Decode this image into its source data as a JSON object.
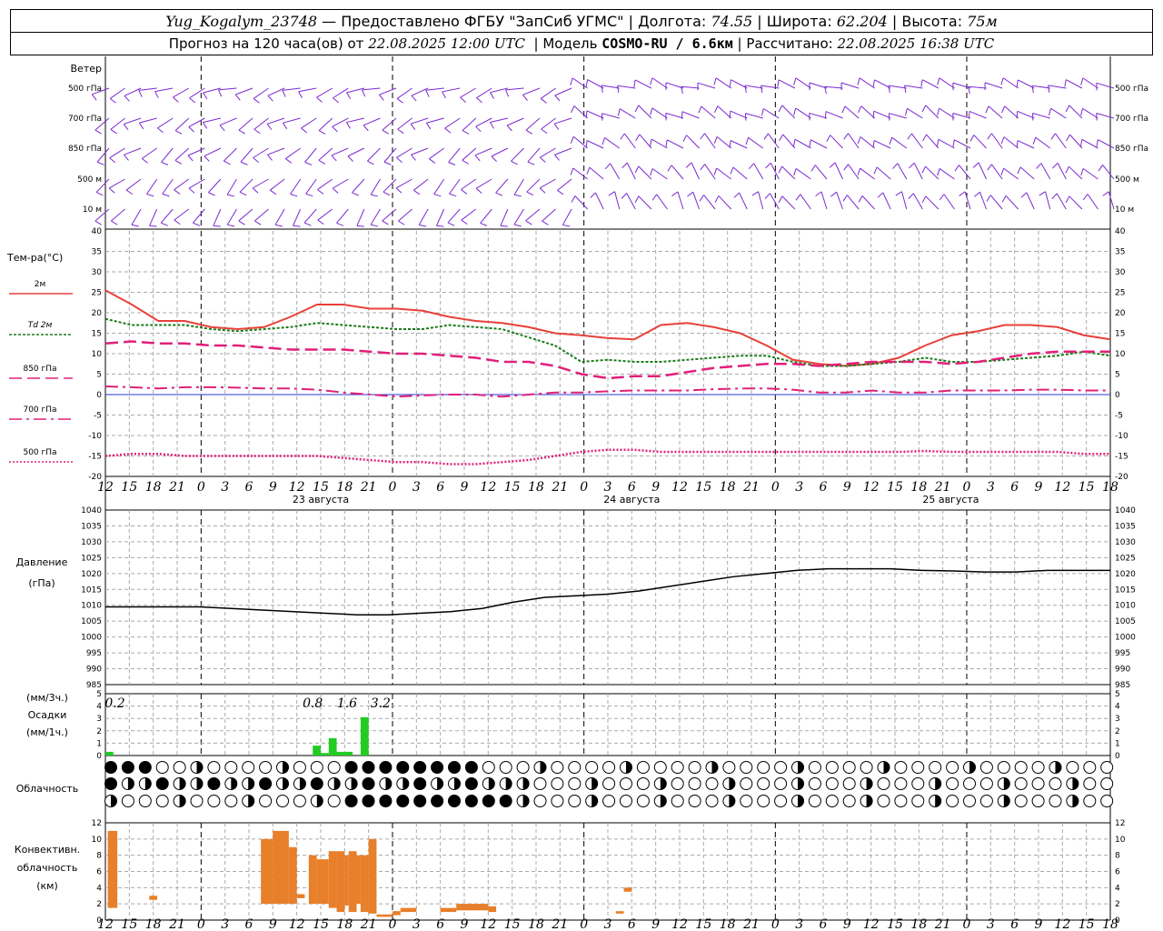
{
  "header": {
    "station": "Yug_Kogalym_23748",
    "provider": "— Предоставлено ФГБУ \"ЗапСиб УГМС\"",
    "lon_label": "Долгота:",
    "lon": "74.55",
    "lat_label": "Широта:",
    "lat": "62.204",
    "alt_label": "Высота:",
    "alt": "75м",
    "forecast_label": "Прогноз на 120 часа(ов) от",
    "forecast_from": "22.08.2025 12:00 UTC",
    "model_label": "Модель",
    "model": "COSMO-RU / 6.6км",
    "computed_label": "Рассчитано:",
    "computed": "22.08.2025 16:38 UTC"
  },
  "panels": {
    "wind": {
      "title": "Ветер",
      "levels": [
        "500 гПа",
        "700 гПа",
        "850 гПа",
        "500 м",
        "10  м"
      ]
    },
    "temp": {
      "title": "Тем-ра(°C)",
      "legend": [
        "2м",
        "Td  2м",
        "850 гПа",
        "700 гПа",
        "500 гПа"
      ]
    },
    "pressure": {
      "title1": "Давление",
      "title2": "(гПа)"
    },
    "precip": {
      "title1": "(мм/3ч.)",
      "title2": "Осадки",
      "title3": "(мм/1ч.)",
      "labels": [
        "0.2",
        "0.8",
        "1.6",
        "3.2"
      ]
    },
    "cloud": {
      "title": "Облачность"
    },
    "conv": {
      "title1": "Конвективн.",
      "title2": "облачность",
      "title3": "(км)"
    }
  },
  "dates": [
    "23 августа",
    "24 августа",
    "25 августа"
  ],
  "colors": {
    "t2m": "#e8403a",
    "td": "#1a7a1a",
    "t850": "#e0207a",
    "t700": "#e0207a",
    "t500": "#e0207a",
    "wind": "#7a2ad0",
    "precip": "#22cc22",
    "conv": "#e87f2a"
  },
  "chart_data": [
    {
      "type": "line",
      "name": "temperature",
      "x_hours": [
        0,
        3,
        6,
        9,
        12,
        15,
        18,
        21,
        24,
        27,
        30,
        33,
        36,
        39,
        42,
        45,
        48,
        51,
        54,
        57,
        60,
        63,
        66,
        69,
        72,
        75,
        78,
        81,
        84,
        87,
        90,
        93,
        96,
        99,
        102,
        105,
        108,
        111,
        114,
        117,
        120,
        123,
        126
      ],
      "x_tick_labels": [
        "12",
        "15",
        "18",
        "21",
        "0",
        "3",
        "6",
        "9",
        "12",
        "15",
        "18",
        "21",
        "0",
        "3",
        "6",
        "9",
        "12",
        "15",
        "18",
        "21",
        "0",
        "3",
        "6",
        "9",
        "12",
        "15",
        "18",
        "21",
        "0",
        "3",
        "6",
        "9",
        "12",
        "15",
        "18",
        "21",
        "0",
        "3",
        "6",
        "9",
        "12",
        "15",
        "18"
      ],
      "ylim": [
        -20,
        40
      ],
      "yticks": [
        -20,
        -15,
        -10,
        -5,
        0,
        5,
        10,
        15,
        20,
        25,
        30,
        35,
        40
      ],
      "series": [
        {
          "name": "2м",
          "values": [
            25.5,
            22,
            18,
            18,
            16.5,
            16,
            16.5,
            19,
            22,
            22,
            21,
            21,
            20.5,
            19,
            18,
            17.5,
            16.5,
            15,
            14.5,
            13.8,
            13.5,
            17,
            17.5,
            16.5,
            15,
            12,
            8.5,
            7.5,
            7,
            7.5,
            9,
            12,
            14.5,
            15.5,
            17,
            17,
            16.5,
            14.5,
            13.5
          ]
        },
        {
          "name": "Td  2м",
          "values": [
            18.5,
            17,
            17,
            17,
            16,
            15.5,
            16,
            16.5,
            17.5,
            17,
            16.5,
            16,
            16,
            17,
            16.5,
            16,
            14,
            12,
            8,
            8.5,
            8,
            8,
            8.5,
            9,
            9.5,
            9.5,
            8,
            7,
            7,
            7.5,
            8,
            9,
            8,
            8,
            8.5,
            9,
            9.5,
            10.5,
            9.5
          ]
        },
        {
          "name": "850 гПа",
          "values": [
            12.5,
            13,
            12.5,
            12.5,
            12,
            12,
            11.5,
            11,
            11,
            11,
            10.5,
            10,
            10,
            9.5,
            9,
            8,
            8,
            7,
            5,
            4,
            4.5,
            4.5,
            5.5,
            6.5,
            7,
            7.5,
            7.5,
            7,
            7.5,
            8,
            8,
            8,
            7.5,
            8,
            9,
            10,
            10.5,
            10.5,
            10.5
          ]
        },
        {
          "name": "700 гПа",
          "values": [
            2,
            1.8,
            1.5,
            1.8,
            1.8,
            1.7,
            1.5,
            1.5,
            1.2,
            0.5,
            0,
            -0.5,
            -0.2,
            0,
            0,
            -0.5,
            0,
            0.5,
            0.5,
            0.8,
            1,
            1,
            1,
            1.3,
            1.5,
            1.5,
            1.2,
            0.5,
            0.5,
            1,
            0.5,
            0.5,
            1,
            1,
            1,
            1.2,
            1.2,
            1,
            1
          ]
        },
        {
          "name": "500 гПа",
          "values": [
            -15,
            -14.5,
            -14.5,
            -15,
            -15,
            -15,
            -15,
            -15,
            -15,
            -15.5,
            -16,
            -16.5,
            -16.5,
            -17,
            -17,
            -16.5,
            -16,
            -15,
            -14,
            -13.5,
            -13.5,
            -14,
            -14,
            -14,
            -14,
            -14,
            -14,
            -14,
            -14,
            -14,
            -14,
            -13.8,
            -14,
            -14,
            -14,
            -14,
            -14,
            -14.5,
            -14.5
          ]
        }
      ]
    },
    {
      "type": "line",
      "name": "pressure",
      "ylim": [
        985,
        1040
      ],
      "yticks": [
        985,
        990,
        995,
        1000,
        1005,
        1010,
        1015,
        1020,
        1025,
        1030,
        1035,
        1040
      ],
      "series": [
        {
          "name": "Давление",
          "values": [
            1009.5,
            1009.5,
            1009.5,
            1009.5,
            1009,
            1008.5,
            1008,
            1007.5,
            1007,
            1007,
            1007.5,
            1008,
            1009,
            1011,
            1012.5,
            1013,
            1013.5,
            1014.5,
            1016,
            1017.5,
            1019,
            1020,
            1021,
            1021.5,
            1021.5,
            1021.5,
            1021,
            1020.8,
            1020.5,
            1020.5,
            1021,
            1021,
            1021
          ]
        }
      ]
    },
    {
      "type": "bar",
      "name": "precipitation",
      "ylim": [
        0,
        5
      ],
      "bars": [
        {
          "hour": 0.5,
          "value": 0.3
        },
        {
          "hour": 26.5,
          "value": 0.8
        },
        {
          "hour": 27.5,
          "value": 0.2
        },
        {
          "hour": 28.5,
          "value": 1.4
        },
        {
          "hour": 29.5,
          "value": 0.3
        },
        {
          "hour": 30.5,
          "value": 0.3
        },
        {
          "hour": 32.5,
          "value": 3.1
        }
      ]
    },
    {
      "type": "bar",
      "name": "convective_cloud",
      "ylim": [
        0,
        12
      ],
      "bars": [
        {
          "h0": 0.3,
          "h1": 1.5,
          "base": 1.5,
          "top": 11
        },
        {
          "h0": 5.5,
          "h1": 6.5,
          "base": 2.5,
          "top": 3
        },
        {
          "h0": 19.5,
          "h1": 21,
          "base": 2,
          "top": 10
        },
        {
          "h0": 21,
          "h1": 23,
          "base": 2,
          "top": 11
        },
        {
          "h0": 23,
          "h1": 24,
          "base": 2,
          "top": 9
        },
        {
          "h0": 24,
          "h1": 25,
          "base": 2.7,
          "top": 3.2
        },
        {
          "h0": 25.5,
          "h1": 26.5,
          "base": 2,
          "top": 8
        },
        {
          "h0": 26.5,
          "h1": 28,
          "base": 2,
          "top": 7.5
        },
        {
          "h0": 28,
          "h1": 29,
          "base": 1.5,
          "top": 8.5
        },
        {
          "h0": 29,
          "h1": 30,
          "base": 1,
          "top": 8.5
        },
        {
          "h0": 30,
          "h1": 30.5,
          "base": 1.8,
          "top": 8
        },
        {
          "h0": 30.5,
          "h1": 31.5,
          "base": 1,
          "top": 8.5
        },
        {
          "h0": 31.5,
          "h1": 32,
          "base": 2,
          "top": 8
        },
        {
          "h0": 32,
          "h1": 33,
          "base": 1,
          "top": 8
        },
        {
          "h0": 33,
          "h1": 34,
          "base": 0.8,
          "top": 10
        },
        {
          "h0": 34,
          "h1": 36,
          "base": 0.4,
          "top": 0.7
        },
        {
          "h0": 36,
          "h1": 37,
          "base": 0.6,
          "top": 1.1
        },
        {
          "h0": 37,
          "h1": 39,
          "base": 1,
          "top": 1.5
        },
        {
          "h0": 42,
          "h1": 44,
          "base": 1,
          "top": 1.5
        },
        {
          "h0": 44,
          "h1": 48,
          "base": 1.2,
          "top": 2
        },
        {
          "h0": 48,
          "h1": 49,
          "base": 1,
          "top": 1.7
        },
        {
          "h0": 64,
          "h1": 65,
          "base": 0.8,
          "top": 1.1
        },
        {
          "h0": 65,
          "h1": 66,
          "base": 3.5,
          "top": 4
        }
      ]
    }
  ]
}
